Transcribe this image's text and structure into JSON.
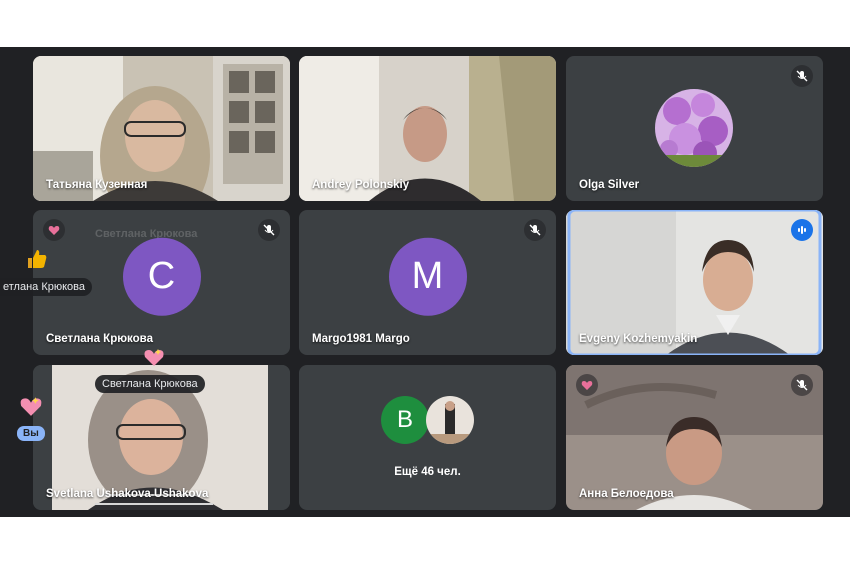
{
  "tiles": [
    {
      "name": "Татьяна Кузенная"
    },
    {
      "name": "Andrey Polonskiy"
    },
    {
      "name": "Olga Silver"
    },
    {
      "name": "Светлана Крюкова",
      "initial": "С"
    },
    {
      "name": "Margo1981 Margo",
      "initial": "M"
    },
    {
      "name": "Evgeny Kozhemyakin"
    },
    {
      "name": "Svetlana Ushakova Ushakova"
    },
    {
      "others_initial": "B",
      "others_label": "Ещё 46 чел."
    },
    {
      "name": "Анна Белоедова"
    }
  ],
  "floating": {
    "ghost_name": "Светлана Крюкова",
    "side_name": "етлана Крюкова",
    "top_name": "Светлана Крюкова",
    "you_label": "Вы"
  },
  "colors": {
    "stage_bg": "#202124",
    "tile_bg": "#3c4043",
    "avatar_purple": "#7e57c2",
    "active_border": "#8ab4f8",
    "speaking_blue": "#1a73e8",
    "green_avatar": "#1e8e3e"
  },
  "icons": [
    "mic-off-icon",
    "heart-icon",
    "thumbs-up-icon",
    "speaking-indicator-icon"
  ]
}
